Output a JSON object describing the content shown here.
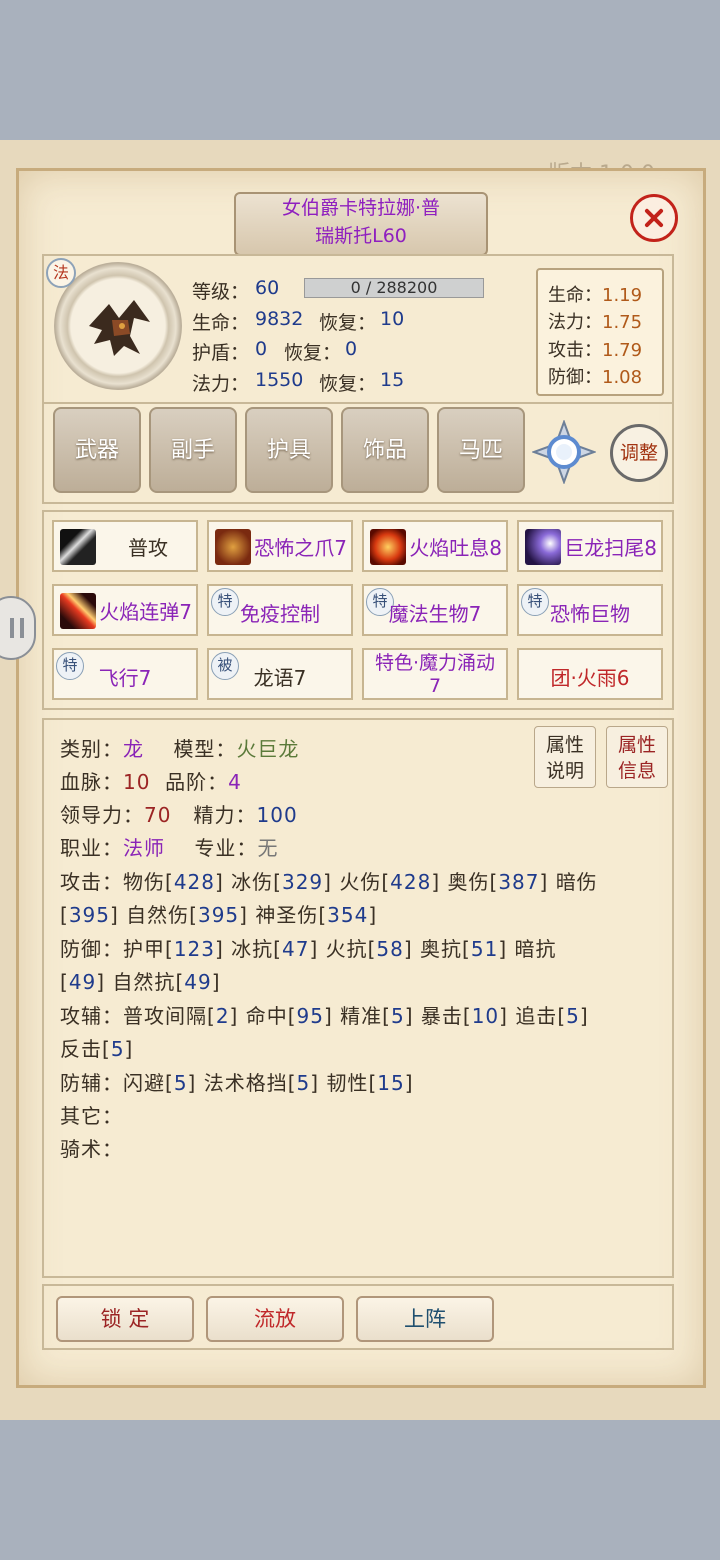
{
  "version_text": "版本 1.0.0",
  "title": {
    "line1": "女伯爵卡特拉娜·普",
    "line2": "瑞斯托L60"
  },
  "class_badge": "法",
  "stats": {
    "level_label": "等级：",
    "level": "60",
    "xp_text": "0 / 288200",
    "xp_progress": 0.0,
    "hp_label": "生命：",
    "hp": "9832",
    "hp_regen_label": "恢复：",
    "hp_regen": "10",
    "shield_label": "护盾：",
    "shield": "0",
    "shield_regen_label": "恢复：",
    "shield_regen": "0",
    "mp_label": "法力：",
    "mp": "1550",
    "mp_regen_label": "恢复：",
    "mp_regen": "15"
  },
  "multipliers": [
    {
      "label": "生命：",
      "value": "1.19"
    },
    {
      "label": "法力：",
      "value": "1.75"
    },
    {
      "label": "攻击：",
      "value": "1.79"
    },
    {
      "label": "防御：",
      "value": "1.08"
    }
  ],
  "equip": [
    "武器",
    "副手",
    "护具",
    "饰品",
    "马匹"
  ],
  "adjust_label": "调整",
  "skills": [
    {
      "label": "普攻"
    },
    {
      "label": "恐怖之爪7"
    },
    {
      "label": "火焰吐息8"
    },
    {
      "label": "巨龙扫尾8"
    },
    {
      "label": "火焰连弹7"
    },
    {
      "tag": "特",
      "label": "免疫控制"
    },
    {
      "tag": "特",
      "label": "魔法生物7"
    },
    {
      "tag": "特",
      "label": "恐怖巨物"
    },
    {
      "tag": "特",
      "label": "飞行7"
    },
    {
      "tag": "被",
      "label": "龙语7"
    },
    {
      "label_line1": "特色·魔力涌动",
      "label_line2": "7"
    },
    {
      "label": "团·火雨6"
    }
  ],
  "attr_buttons": {
    "b1_l1": "属性",
    "b1_l2": "说明",
    "b2_l1": "属性",
    "b2_l2": "信息"
  },
  "info": {
    "category_label": "类别：",
    "category": "龙",
    "model_label": "模型：",
    "model": "火巨龙",
    "bloodline_label": "血脉：",
    "bloodline": "10",
    "grade_label": "品阶：",
    "grade": "4",
    "leadership_label": "领导力：",
    "leadership": "70",
    "energy_label": "精力：",
    "energy": "100",
    "job_label": "职业：",
    "job": "法师",
    "spec_label": "专业：",
    "spec": "无",
    "attack_label": "攻击：",
    "attack": [
      {
        "name": "物伤",
        "value": "428"
      },
      {
        "name": "冰伤",
        "value": "329"
      },
      {
        "name": "火伤",
        "value": "428"
      },
      {
        "name": "奥伤",
        "value": "387"
      },
      {
        "name": "暗伤",
        "value": "395"
      },
      {
        "name": "自然伤",
        "value": "395"
      },
      {
        "name": "神圣伤",
        "value": "354"
      }
    ],
    "defense_label": "防御：",
    "defense": [
      {
        "name": "护甲",
        "value": "123"
      },
      {
        "name": "冰抗",
        "value": "47"
      },
      {
        "name": "火抗",
        "value": "58"
      },
      {
        "name": "奥抗",
        "value": "51"
      },
      {
        "name": "暗抗",
        "value": "49"
      },
      {
        "name": "自然抗",
        "value": "49"
      }
    ],
    "attack_aux_label": "攻辅：",
    "attack_aux": [
      {
        "name": "普攻间隔",
        "value": "2"
      },
      {
        "name": "命中",
        "value": "95"
      },
      {
        "name": "精准",
        "value": "5"
      },
      {
        "name": "暴击",
        "value": "10"
      },
      {
        "name": "追击",
        "value": "5"
      },
      {
        "name": "反击",
        "value": "5"
      }
    ],
    "defense_aux_label": "防辅：",
    "defense_aux": [
      {
        "name": "闪避",
        "value": "5"
      },
      {
        "name": "法术格挡",
        "value": "5"
      },
      {
        "name": "韧性",
        "value": "15"
      }
    ],
    "other_label": "其它：",
    "riding_label": "骑术："
  },
  "buttons": {
    "lock": "锁 定",
    "exile": "流放",
    "deploy": "上阵"
  }
}
